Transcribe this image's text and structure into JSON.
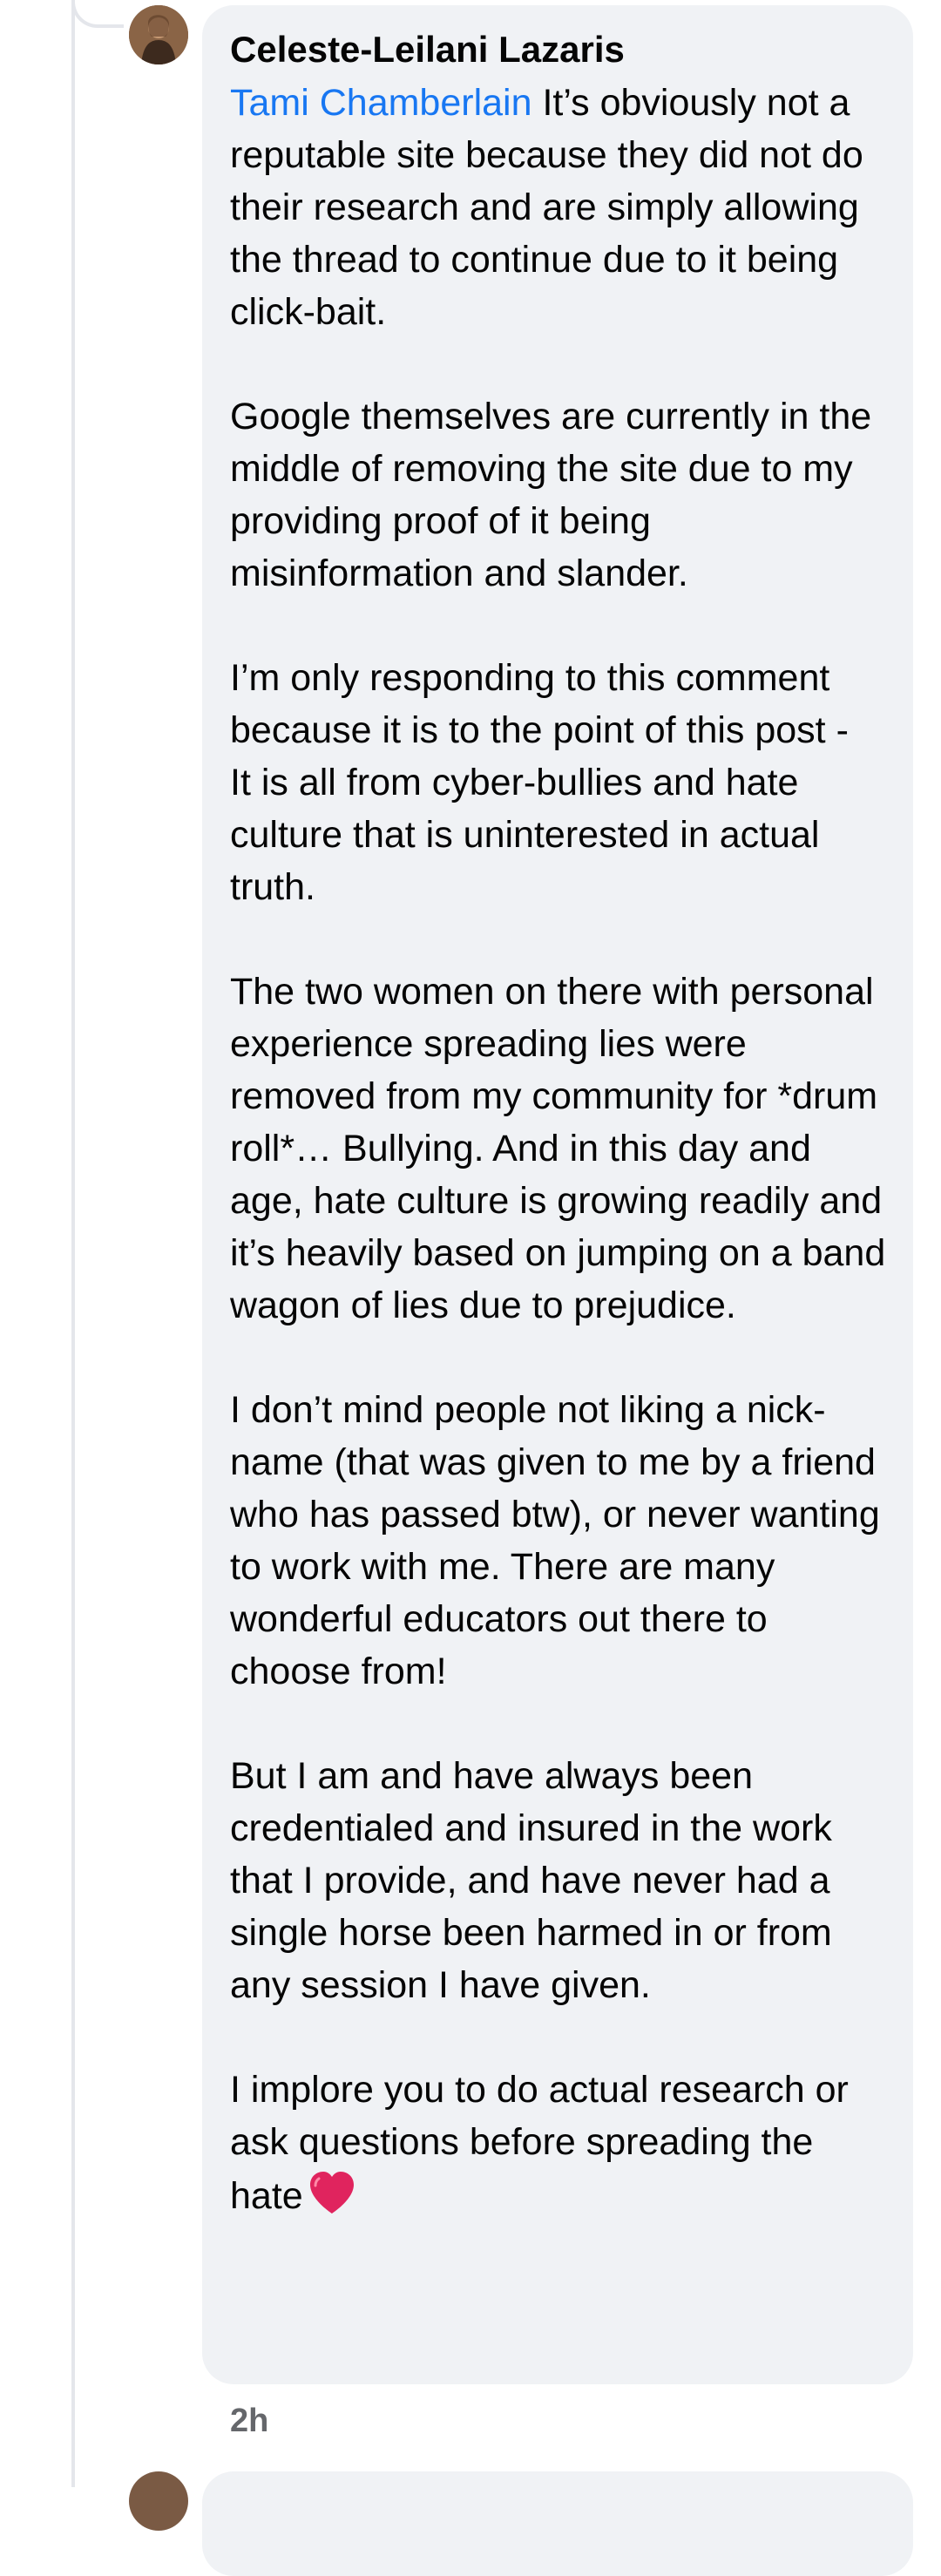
{
  "comment": {
    "author": "Celeste-Leilani Lazaris",
    "mention": "Tami Chamberlain",
    "paragraphs": [
      " It’s obviously not a reputable site because they did not do their research and are simply allowing the thread to continue due to it being click-bait.",
      "Google themselves are currently in the middle of removing the site due to my providing proof of it being misinformation and slander.",
      "I’m only responding to this comment because it is to the point of this post -\nIt is all from cyber-bullies and hate culture that is uninterested in actual truth.",
      "The two women on there with personal experience spreading lies were removed from my community for *drum roll*… Bullying. And in this day and age, hate culture is growing readily and it’s heavily based on jumping on a band wagon of lies due to prejudice.",
      "I don’t mind people not liking a nick-name (that was given to me by a friend who has passed btw), or never wanting to work with me. There are many wonderful educators out there to choose from!",
      "But I am and have always been credentialed and insured in the work that I provide, and have never had a single horse been harmed in or from any session I have given.",
      "I implore you to do actual research or ask questions before spreading the hate"
    ],
    "emoji": "red-heart-icon",
    "timestamp": "2h"
  },
  "colors": {
    "bubble": "#f0f2f5",
    "mention": "#1877f2",
    "muted": "#65676b",
    "heart": "#e0245e"
  }
}
